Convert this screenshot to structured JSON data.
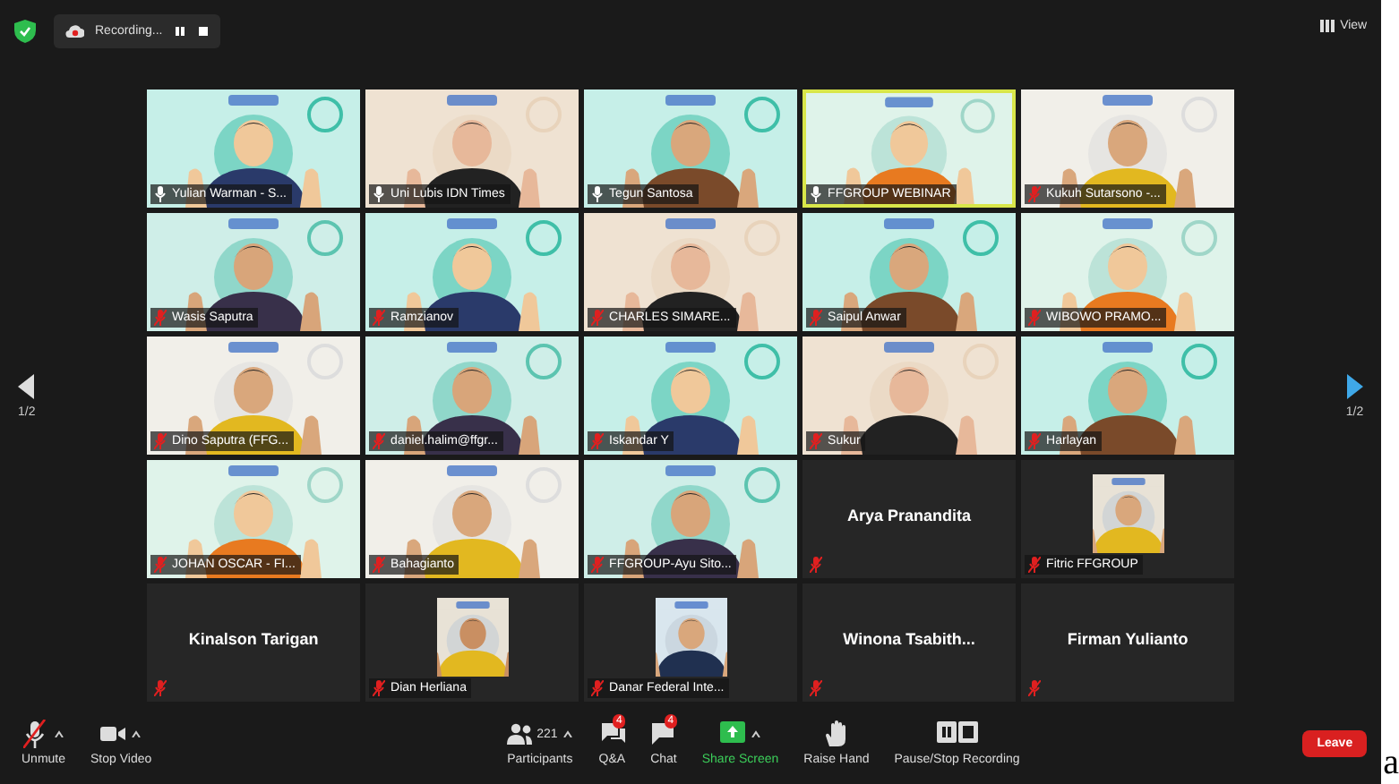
{
  "top_bar": {
    "recording": {
      "label": "Recording..."
    },
    "view_button": {
      "label": "View"
    }
  },
  "pager": {
    "left": "1/2",
    "right": "1/2"
  },
  "tiles": [
    {
      "kind": "video",
      "name": "Yulian Warman - S...",
      "muted": false,
      "active": false
    },
    {
      "kind": "video",
      "name": "Uni Lubis IDN Times",
      "muted": false,
      "active": false
    },
    {
      "kind": "video",
      "name": "Tegun Santosa",
      "muted": false,
      "active": false
    },
    {
      "kind": "video",
      "name": "FFGROUP WEBINAR",
      "muted": false,
      "active": true
    },
    {
      "kind": "video",
      "name": "Kukuh Sutarsono -...",
      "muted": true,
      "active": false
    },
    {
      "kind": "video",
      "name": "Wasis Saputra",
      "muted": true,
      "active": false
    },
    {
      "kind": "video",
      "name": "Ramzianov",
      "muted": true,
      "active": false
    },
    {
      "kind": "video",
      "name": "CHARLES SIMARE...",
      "muted": true,
      "active": false
    },
    {
      "kind": "video",
      "name": "Saipul Anwar",
      "muted": true,
      "active": false
    },
    {
      "kind": "video",
      "name": "WIBOWO PRAMO...",
      "muted": true,
      "active": false
    },
    {
      "kind": "video",
      "name": "Dino Saputra (FFG...",
      "muted": true,
      "active": false
    },
    {
      "kind": "video",
      "name": "daniel.halim@ffgr...",
      "muted": true,
      "active": false
    },
    {
      "kind": "video",
      "name": "Iskandar Y",
      "muted": true,
      "active": false
    },
    {
      "kind": "video",
      "name": "Sukur",
      "muted": true,
      "active": false
    },
    {
      "kind": "video",
      "name": "Harlayan",
      "muted": true,
      "active": false
    },
    {
      "kind": "video",
      "name": "JOHAN OSCAR - FI...",
      "muted": true,
      "active": false
    },
    {
      "kind": "video",
      "name": "Bahagianto",
      "muted": true,
      "active": false
    },
    {
      "kind": "video",
      "name": "FFGROUP-Ayu Sito...",
      "muted": true,
      "active": false
    },
    {
      "kind": "name",
      "name": "Arya Pranandita",
      "muted": true,
      "active": false
    },
    {
      "name": "Fitric FFGROUP",
      "muted": true,
      "active": false
    },
    {
      "kind": "name",
      "name": "Kinalson Tarigan",
      "muted": true,
      "active": false
    },
    {
      "name": "Dian Herliana",
      "muted": true,
      "active": false
    },
    {
      "name": "Danar Federal Inte...",
      "muted": true,
      "active": false
    },
    {
      "kind": "name",
      "name": "Winona  Tsabith...",
      "muted": true,
      "active": false
    },
    {
      "kind": "name",
      "name": "Firman Yulianto",
      "muted": true,
      "active": false
    }
  ],
  "toolbar": {
    "left": [
      {
        "kind": "mic",
        "label": "Unmute",
        "muted": true,
        "caret": true
      },
      {
        "kind": "video",
        "label": "Stop Video",
        "caret": true
      }
    ],
    "center": [
      {
        "kind": "participants",
        "label": "Participants",
        "count": "221",
        "caret": true
      },
      {
        "kind": "qa",
        "label": "Q&A",
        "badge": "4",
        "caret": false
      },
      {
        "kind": "chat",
        "label": "Chat",
        "badge": "4",
        "caret": false
      },
      {
        "kind": "share",
        "label": "Share Screen",
        "caret": true
      },
      {
        "kind": "hand",
        "label": "Raise Hand",
        "caret": false
      },
      {
        "kind": "recording",
        "label": "Pause/Stop Recording",
        "caret": false
      }
    ],
    "leave": {
      "label": "Leave"
    }
  },
  "outside_text": "a"
}
